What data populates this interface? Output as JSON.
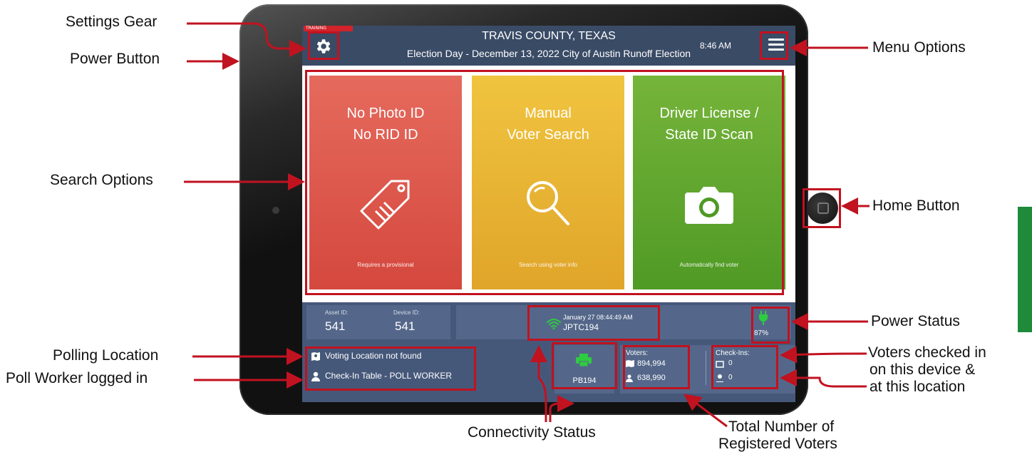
{
  "callouts": {
    "settings_gear": "Settings Gear",
    "power_button": "Power Button",
    "search_options": "Search Options",
    "polling_location": "Polling Location",
    "poll_worker": "Poll Worker logged in",
    "menu_options": "Menu Options",
    "home_button": "Home Button",
    "power_status": "Power Status",
    "voters_checked_in_1": "Voters checked in",
    "voters_checked_in_2": "on this device &",
    "voters_checked_in_3": "at this location",
    "connectivity_status": "Connectivity Status",
    "total_voters_1": "Total Number of",
    "total_voters_2": "Registered Voters"
  },
  "header": {
    "training": "TRAINING",
    "title": "TRAVIS COUNTY, TEXAS",
    "subtitle": "Election Day - December 13, 2022 City of Austin Runoff Election",
    "time": "8:46 AM"
  },
  "cards": [
    {
      "line1": "No Photo ID",
      "line2": "No RID ID",
      "hint": "Requires a provisional",
      "icon": "tag-icon"
    },
    {
      "line1": "Manual",
      "line2": "Voter Search",
      "hint": "Search using voter info",
      "icon": "magnifier-icon"
    },
    {
      "line1": "Driver License /",
      "line2": "State ID Scan",
      "hint": "Automatically find voter",
      "icon": "camera-icon"
    }
  ],
  "footer": {
    "asset_label": "Asset ID:",
    "asset_value": "541",
    "device_label": "Device ID:",
    "device_value": "541",
    "conn_date": "January 27  08:44:49 AM",
    "conn_device": "JPTC194",
    "battery": "87%",
    "location": "Voting Location not found",
    "worker": "Check-In Table - POLL WORKER",
    "printer": "PB194",
    "voters_label": "Voters:",
    "voters_total": "894,994",
    "voters_other": "638,990",
    "checkins_label": "Check-Ins:",
    "checkins_device": "0",
    "checkins_location": "0"
  },
  "colors": {
    "accent_red": "#c1121f",
    "header_bg": "#3a4b66",
    "card_red": "#d5483e",
    "card_yellow": "#e0a52a",
    "card_green": "#4f9a25",
    "status_green": "#2ecc40"
  }
}
